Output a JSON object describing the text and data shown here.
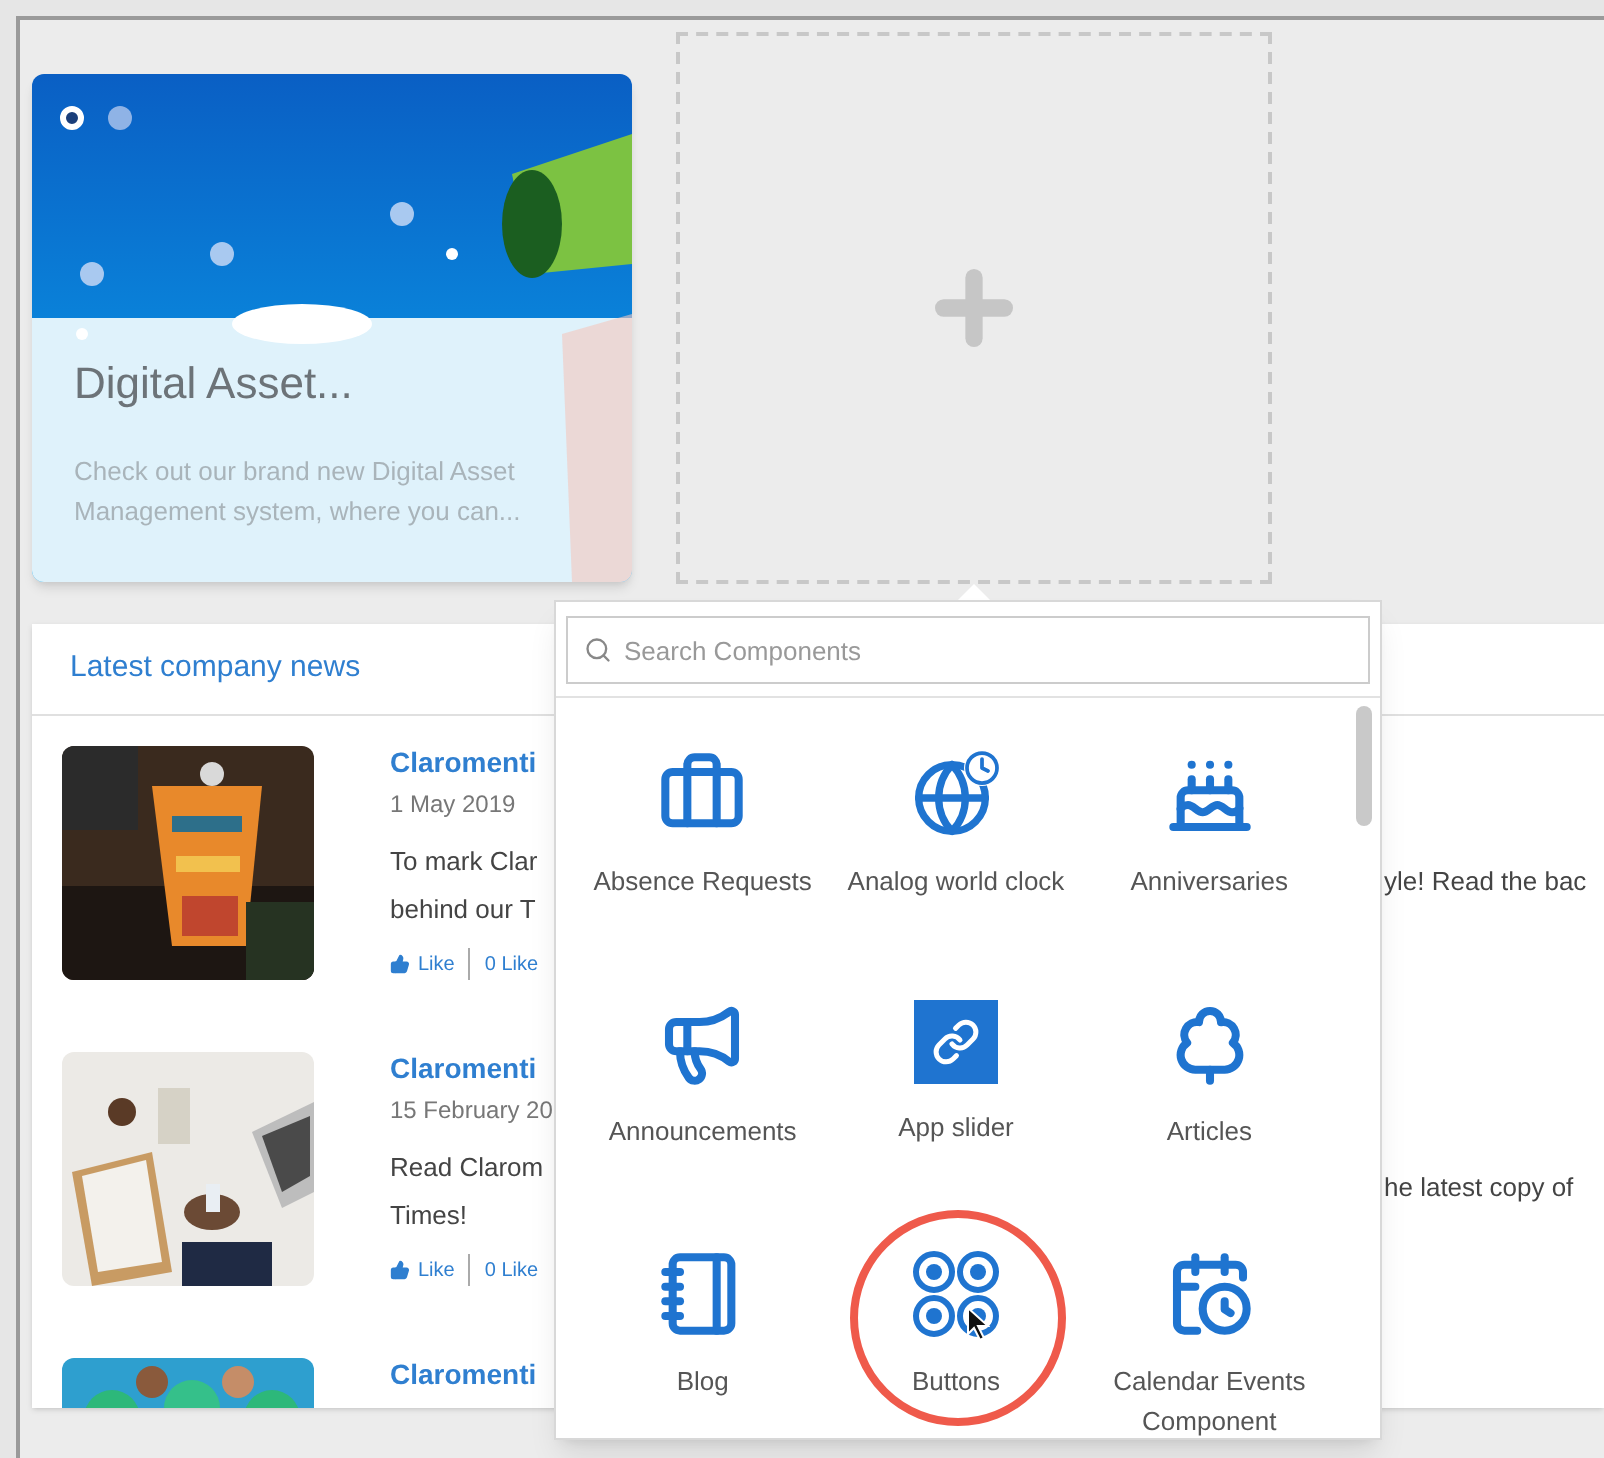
{
  "feature_card": {
    "title": "Digital Asset...",
    "description": "Check out our brand new Digital Asset Management system, where you can...",
    "slides": [
      {
        "selected": true
      },
      {
        "selected": false
      }
    ]
  },
  "placeholder_tile": {
    "kind": "add"
  },
  "news": {
    "title": "Latest company news",
    "items": [
      {
        "title": "Claromenti",
        "date": "1 May 2019",
        "lines": [
          "To mark Clar",
          "behind our T"
        ],
        "tail": "yle! Read the bac",
        "like": "Like",
        "likes": "0 Like"
      },
      {
        "title": "Claromenti",
        "date": "15 February 20",
        "lines": [
          "Read Clarom",
          "Times!"
        ],
        "tail": "he latest copy of",
        "like": "Like",
        "likes": "0 Like"
      },
      {
        "title": "Claromenti"
      }
    ]
  },
  "components_popup": {
    "search": {
      "placeholder": "Search Components"
    },
    "items": [
      {
        "label": "Absence Requests",
        "kind": "briefcase",
        "highlighted": false
      },
      {
        "label": "Analog world clock",
        "kind": "globe",
        "highlighted": false
      },
      {
        "label": "Anniversaries",
        "kind": "cake",
        "highlighted": false
      },
      {
        "label": "Announcements",
        "kind": "megaphone",
        "highlighted": false
      },
      {
        "label": "App slider",
        "kind": "link",
        "highlighted": false
      },
      {
        "label": "Articles",
        "kind": "tree",
        "highlighted": false
      },
      {
        "label": "Blog",
        "kind": "notebook",
        "highlighted": false
      },
      {
        "label": "Buttons",
        "kind": "buttons",
        "highlighted": true
      },
      {
        "label": "Calendar Events Component",
        "kind": "calendar",
        "highlighted": false
      }
    ]
  }
}
